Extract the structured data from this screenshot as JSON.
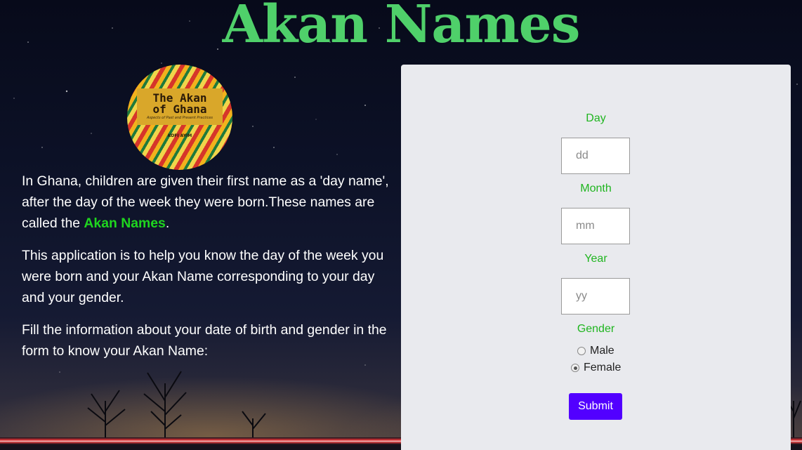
{
  "page": {
    "title": "Akan Names"
  },
  "logo": {
    "line1": "The Akan",
    "line2": "of Ghana",
    "subtitle": "Aspects of Past and Present Practices",
    "author": "KOFI AYIM"
  },
  "intro": {
    "p1_before": "In Ghana, children are given their first name as a 'day name', after the day of the week they were born.These names are called the ",
    "p1_highlight": "Akan Names",
    "p1_after": ".",
    "p2": "This application is to help you know the day of the week you were born and your Akan Name corresponding to your day and your gender.",
    "p3": "Fill the information about your date of birth and gender in the form to know your Akan Name:"
  },
  "form": {
    "day_label": "Day",
    "day_placeholder": "dd",
    "month_label": "Month",
    "month_placeholder": "mm",
    "year_label": "Year",
    "year_placeholder": "yy",
    "gender_label": "Gender",
    "gender_options": [
      {
        "label": "Male",
        "checked": false
      },
      {
        "label": "Female",
        "checked": true
      }
    ],
    "submit_label": "Submit"
  },
  "colors": {
    "title": "#4fd06a",
    "highlight": "#1fd51f",
    "label": "#1fb51f",
    "panel_bg": "#e9eaee",
    "submit_bg": "#5200ff"
  }
}
